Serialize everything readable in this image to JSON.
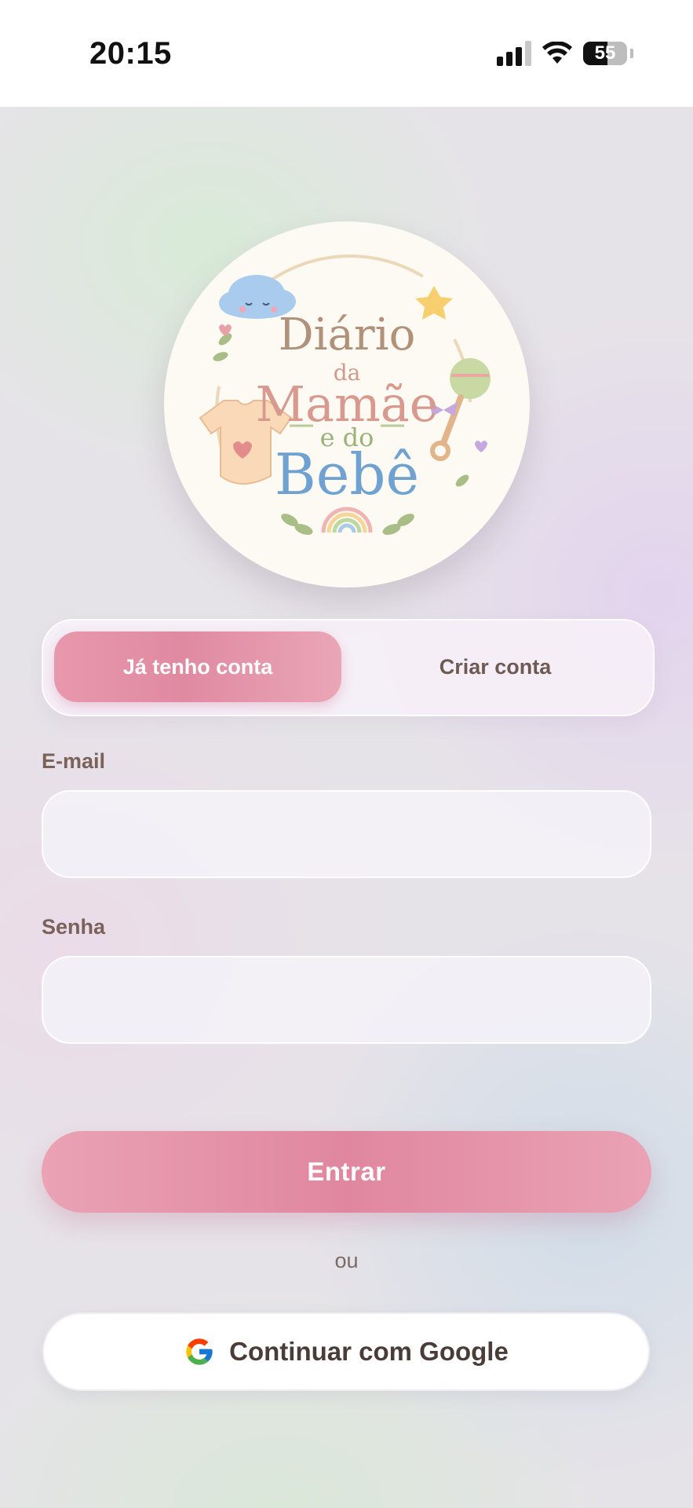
{
  "status_bar": {
    "time": "20:15",
    "battery": "55"
  },
  "logo": {
    "line1": "Diário",
    "line2": "da",
    "line3": "Mamãe",
    "line4": "e do",
    "line5": "Bebê"
  },
  "tabs": [
    {
      "label": "Já tenho conta",
      "active": true
    },
    {
      "label": "Criar conta",
      "active": false
    }
  ],
  "form": {
    "email_label": "E-mail",
    "email_value": "",
    "password_label": "Senha",
    "password_value": "",
    "submit_label": "Entrar",
    "separator": "ou",
    "google_label": "Continuar com Google"
  },
  "icons": {
    "google": "google-g-icon",
    "wifi": "wifi-icon",
    "signal": "cellular-signal-icon",
    "battery": "battery-icon"
  },
  "colors": {
    "accent_pink": "#e0879f",
    "label_brown": "#7a625a"
  }
}
